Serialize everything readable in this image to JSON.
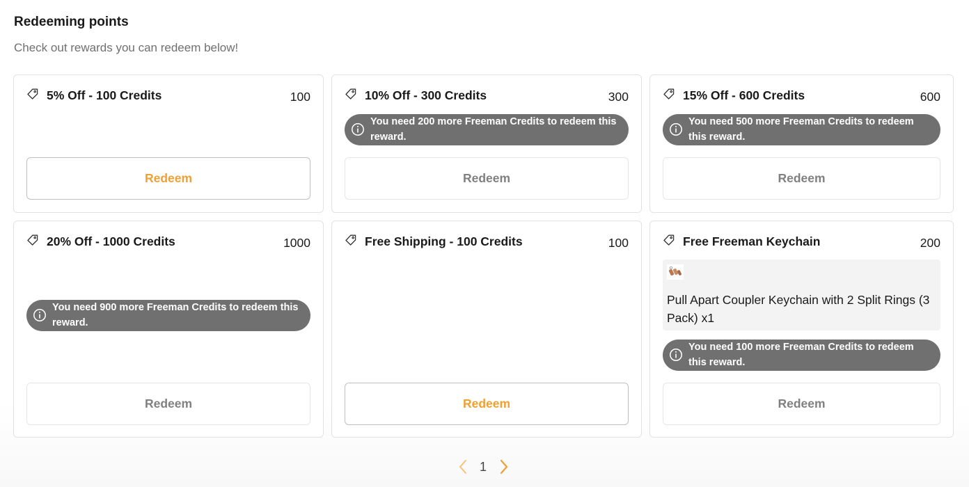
{
  "page": {
    "title": "Redeeming points",
    "subtitle": "Check out rewards you can redeem below!"
  },
  "colors": {
    "accent": "#f0a030",
    "notice_bg": "#707070",
    "disabled_text": "#808080"
  },
  "rewards": [
    {
      "icon": "tag-icon",
      "title": "5% Off - 100 Credits",
      "points": "100",
      "notice": "",
      "button": "Redeem",
      "enabled": true
    },
    {
      "icon": "tag-icon",
      "title": "10% Off - 300 Credits",
      "points": "300",
      "notice": "You need 200 more Freeman Credits to redeem this reward.",
      "button": "Redeem",
      "enabled": false
    },
    {
      "icon": "tag-icon",
      "title": "15% Off - 600 Credits",
      "points": "600",
      "notice": "You need 500 more Freeman Credits to redeem this reward.",
      "button": "Redeem",
      "enabled": false
    },
    {
      "icon": "tag-icon",
      "title": "20% Off - 1000 Credits",
      "points": "1000",
      "notice": "You need 900 more Freeman Credits to redeem this reward.",
      "button": "Redeem",
      "enabled": false
    },
    {
      "icon": "tag-icon",
      "title": "Free Shipping - 100 Credits",
      "points": "100",
      "notice": "",
      "button": "Redeem",
      "enabled": true
    },
    {
      "icon": "tag-icon",
      "title": "Free Freeman Keychain",
      "points": "200",
      "product": {
        "name": "Pull Apart Coupler Keychain with 2 Split Rings (3 Pack) x1",
        "thumb_icon": "keychain-thumbnail"
      },
      "notice": "You need 100 more Freeman Credits to redeem this reward.",
      "button": "Redeem",
      "enabled": false
    }
  ],
  "pagination": {
    "prev_icon": "chevron-left-icon",
    "current_page": "1",
    "next_icon": "chevron-right-icon"
  }
}
